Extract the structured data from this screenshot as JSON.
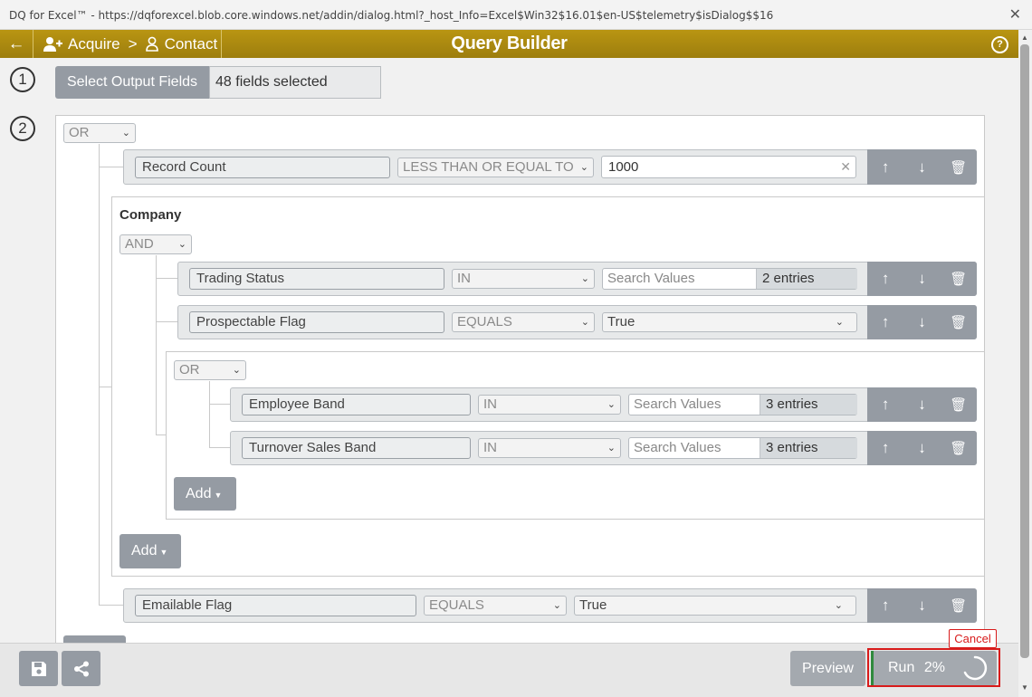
{
  "window": {
    "title": "DQ for Excel™ - https://dqforexcel.blob.core.windows.net/addin/dialog.html?_host_Info=Excel$Win32$16.01$en-US$telemetry$isDialog$$16",
    "close": "✕"
  },
  "header": {
    "back": "←",
    "crumb_acquire": "Acquire",
    "crumb_sep": ">",
    "crumb_contact": "Contact",
    "title": "Query Builder",
    "help": "?"
  },
  "step1": {
    "num": "1",
    "button": "Select Output Fields",
    "value": "48 fields selected"
  },
  "step2": {
    "num": "2"
  },
  "root": {
    "op": "OR"
  },
  "record_count": {
    "field": "Record Count",
    "op": "LESS THAN OR EQUAL TO",
    "value": "1000",
    "clear": "✕"
  },
  "company": {
    "title": "Company",
    "op": "AND"
  },
  "trading_status": {
    "field": "Trading Status",
    "op": "IN",
    "placeholder": "Search Values",
    "entries": "2 entries"
  },
  "prospectable": {
    "field": "Prospectable Flag",
    "op": "EQUALS",
    "value": "True"
  },
  "sub": {
    "op": "OR"
  },
  "employee_band": {
    "field": "Employee Band",
    "op": "IN",
    "placeholder": "Search Values",
    "entries": "3 entries"
  },
  "turnover": {
    "field": "Turnover Sales Band",
    "op": "IN",
    "placeholder": "Search Values",
    "entries": "3 entries"
  },
  "add_inner": "Add",
  "add_company": "Add",
  "emailable": {
    "field": "Emailable Flag",
    "op": "EQUALS",
    "value": "True"
  },
  "icons": {
    "up": "↑",
    "down": "↓",
    "trash": "🗑",
    "chevron": "⌄"
  },
  "footer": {
    "preview": "Preview",
    "run": "Run",
    "run_progress": "2%",
    "cancel": "Cancel"
  }
}
